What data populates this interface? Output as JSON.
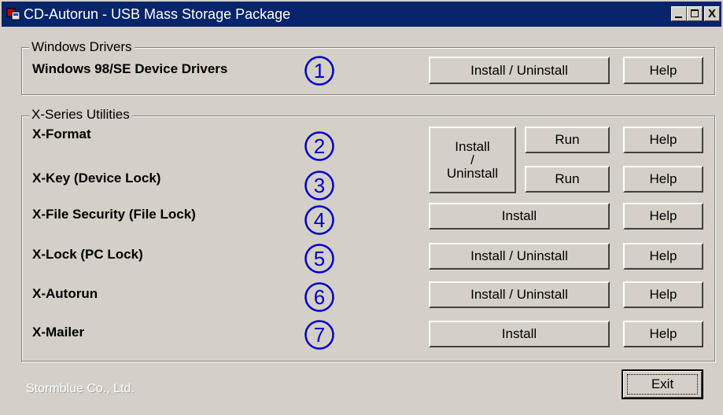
{
  "window": {
    "title": "CD-Autorun - USB Mass Storage Package",
    "controls": {
      "minimize": "_",
      "maximize": "□",
      "close": "X"
    }
  },
  "groups": {
    "drivers": {
      "legend": "Windows Drivers",
      "rows": [
        {
          "label": "Windows 98/SE Device Drivers",
          "number": "1",
          "install_label": "Install / Uninstall",
          "help_label": "Help"
        }
      ]
    },
    "utilities": {
      "legend": "X-Series Utilities",
      "rows": [
        {
          "label": "X-Format",
          "number": "2",
          "run_label": "Run",
          "help_label": "Help"
        },
        {
          "label": "X-Key (Device Lock)",
          "number": "3",
          "run_label": "Run",
          "help_label": "Help"
        },
        {
          "label": "X-File Security (File Lock)",
          "number": "4",
          "install_label": "Install",
          "help_label": "Help"
        },
        {
          "label": "X-Lock (PC Lock)",
          "number": "5",
          "install_label": "Install / Uninstall",
          "help_label": "Help"
        },
        {
          "label": "X-Autorun",
          "number": "6",
          "install_label": "Install / Uninstall",
          "help_label": "Help"
        },
        {
          "label": "X-Mailer",
          "number": "7",
          "install_label": "Install",
          "help_label": "Help"
        }
      ],
      "shared_install": {
        "line1": "Install",
        "line2": "/",
        "line3": "Uninstall"
      }
    }
  },
  "footer": {
    "company": "Stormblue Co., Ltd.",
    "exit_label": "Exit"
  },
  "colors": {
    "titlebar": "#08246b",
    "face": "#d4d0c8",
    "circle_number": "#0000c8"
  },
  "icons": {
    "app": "usb-package-icon"
  }
}
